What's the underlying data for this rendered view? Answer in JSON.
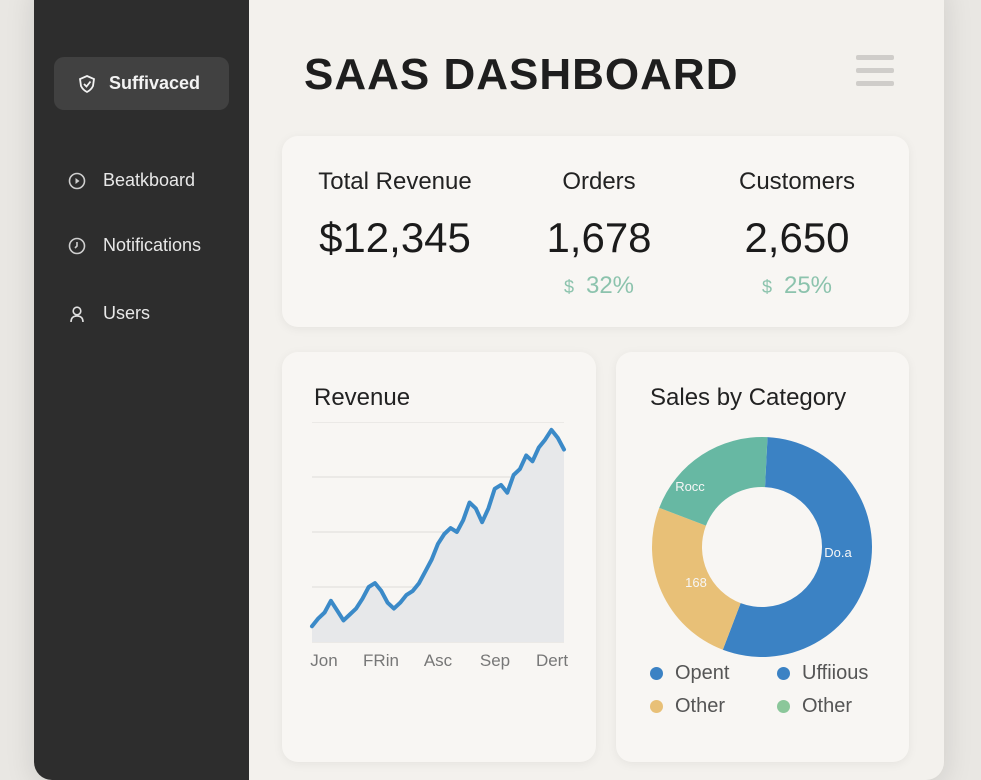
{
  "sidebar": {
    "brand_label": "Suffivaced",
    "items": [
      {
        "label": "Beatkboard",
        "icon": "play-circle-icon"
      },
      {
        "label": "Notifications",
        "icon": "clock-icon"
      },
      {
        "label": "Users",
        "icon": "user-icon"
      }
    ]
  },
  "header": {
    "title": "SAAS DASHBOARD",
    "menu_icon": "hamburger-menu-icon"
  },
  "stats": [
    {
      "label": "Total Revenue",
      "value": "$12,345",
      "change_currency": "",
      "change": ""
    },
    {
      "label": "Orders",
      "value": "1,678",
      "change_currency": "$",
      "change": "32%"
    },
    {
      "label": "Customers",
      "value": "2,650",
      "change_currency": "$",
      "change": "25%"
    }
  ],
  "revenue_card": {
    "title": "Revenue"
  },
  "sales_card": {
    "title": "Sales by Category",
    "segment_labels": [
      "Rocc",
      "Do.a",
      "168"
    ],
    "legend": [
      {
        "label": "Opent",
        "color": "#3b82c4"
      },
      {
        "label": "Uffiious",
        "color": "#3b82c4"
      },
      {
        "label": "Other",
        "color": "#e8c077"
      },
      {
        "label": "Other",
        "color": "#8bc79a"
      }
    ]
  },
  "colors": {
    "sidebar_bg": "#2d2d2d",
    "accent_blue": "#3b82c4",
    "accent_green": "#67b8a3",
    "accent_yellow": "#e8c077",
    "positive_change": "#8cc3ad"
  },
  "chart_data": [
    {
      "type": "area",
      "title": "Revenue",
      "categories": [
        "Jon",
        "FRin",
        "Asc",
        "Sep",
        "Dert"
      ],
      "x": [
        0,
        1,
        2,
        3,
        4,
        5,
        6,
        7,
        8,
        9,
        10,
        11,
        12,
        13,
        14,
        15,
        16,
        17,
        18,
        19,
        20,
        21,
        22,
        23,
        24,
        25,
        26,
        27,
        28,
        29,
        30,
        31,
        32,
        33,
        34,
        35,
        36,
        37,
        38,
        39,
        40
      ],
      "series": [
        {
          "values": [
            8,
            12,
            15,
            21,
            16,
            11,
            14,
            17,
            22,
            28,
            30,
            26,
            20,
            17,
            20,
            24,
            26,
            30,
            36,
            42,
            50,
            55,
            58,
            56,
            62,
            71,
            68,
            61,
            68,
            78,
            80,
            76,
            85,
            88,
            95,
            92,
            99,
            103,
            108,
            104,
            98
          ]
        }
      ],
      "ylim": [
        0,
        112
      ],
      "grid": true
    },
    {
      "type": "pie",
      "title": "Sales by Category",
      "labels": [
        "Do.a",
        "168",
        "Rocc"
      ],
      "values": [
        55,
        25,
        20
      ],
      "colors": [
        "#3b82c4",
        "#e8c077",
        "#67b8a3"
      ],
      "donut": true
    }
  ]
}
